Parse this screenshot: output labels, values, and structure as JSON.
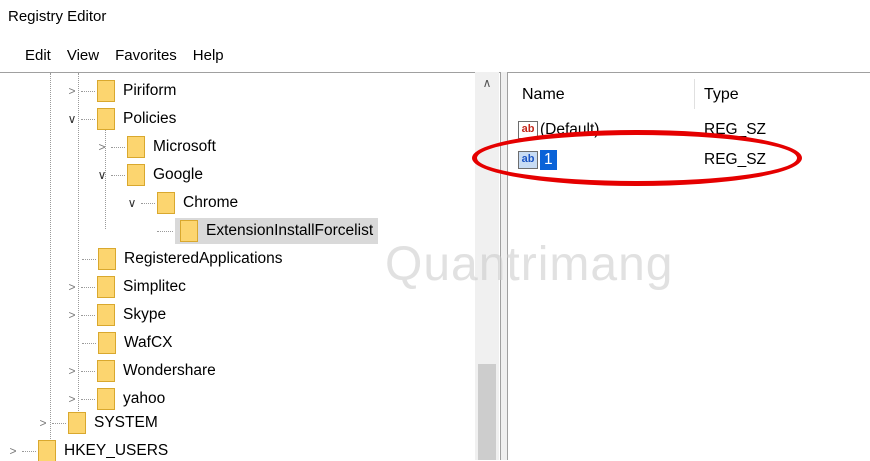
{
  "window": {
    "title": "Registry Editor"
  },
  "menu": [
    "Edit",
    "View",
    "Favorites",
    "Help"
  ],
  "tree": {
    "nodes": [
      {
        "label": "Piriform",
        "expanded": false
      },
      {
        "label": "Policies",
        "expanded": true
      },
      {
        "label": "Microsoft",
        "expanded": false
      },
      {
        "label": "Google",
        "expanded": true
      },
      {
        "label": "Chrome",
        "expanded": true
      },
      {
        "label": "ExtensionInstallForcelist",
        "selected": true
      },
      {
        "label": "RegisteredApplications"
      },
      {
        "label": "Simplitec",
        "expanded": false
      },
      {
        "label": "Skype",
        "expanded": false
      },
      {
        "label": "WafCX"
      },
      {
        "label": "Wondershare",
        "expanded": false
      },
      {
        "label": "yahoo",
        "expanded": false
      },
      {
        "label": "SYSTEM",
        "expanded": false
      },
      {
        "label": "HKEY_USERS",
        "expanded": false
      }
    ]
  },
  "list": {
    "columns": {
      "name": "Name",
      "type": "Type"
    },
    "rows": [
      {
        "icon": "ab",
        "name": "(Default)",
        "type": "REG_SZ"
      },
      {
        "icon": "ab",
        "name": "1",
        "type": "REG_SZ",
        "selected": true
      }
    ]
  },
  "watermark": {
    "text": "Quantrimang"
  },
  "colors": {
    "highlight_ellipse": "#e50000",
    "selection": "#0a63d8",
    "folder": "#fcd56f"
  }
}
